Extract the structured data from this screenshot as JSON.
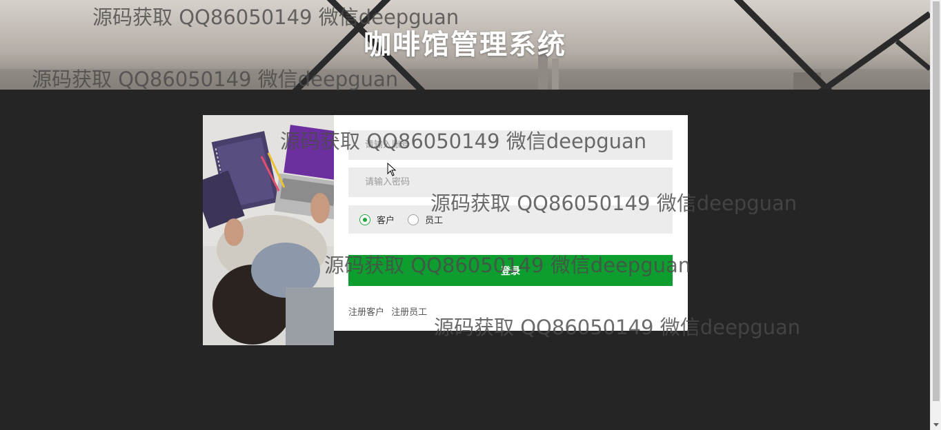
{
  "header": {
    "title": "咖啡馆管理系统"
  },
  "login": {
    "account_placeholder": "请输入账号",
    "password_placeholder": "请输入密码",
    "roles": [
      {
        "label": "客户",
        "selected": true
      },
      {
        "label": "员工",
        "selected": false
      }
    ],
    "submit_label": "登录",
    "register_customer_label": "注册客户",
    "register_staff_label": "注册员工"
  },
  "watermark": {
    "text": "源码获取 QQ86050149 微信deepguan"
  },
  "colors": {
    "page_background": "#252525",
    "primary_button": "#0e9e2f",
    "radio_checked": "#22a743",
    "input_background": "#ececec"
  },
  "icons": {
    "cursor": "mouse-pointer-icon"
  }
}
